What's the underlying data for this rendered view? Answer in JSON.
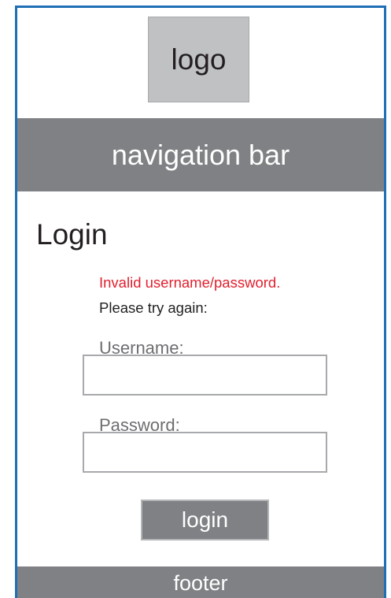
{
  "header": {
    "logo_text": "logo"
  },
  "navigation": {
    "label": "navigation bar"
  },
  "main": {
    "title": "Login",
    "error_message": "Invalid username/password.",
    "instruction": "Please try again:",
    "username": {
      "label": "Username:",
      "value": ""
    },
    "password": {
      "label": "Password:",
      "value": ""
    },
    "submit_label": "login"
  },
  "footer": {
    "label": "footer"
  },
  "colors": {
    "frame_border": "#1f6fb5",
    "bar_gray": "#808184",
    "logo_gray": "#c0c1c3",
    "error_red": "#e0202e"
  }
}
